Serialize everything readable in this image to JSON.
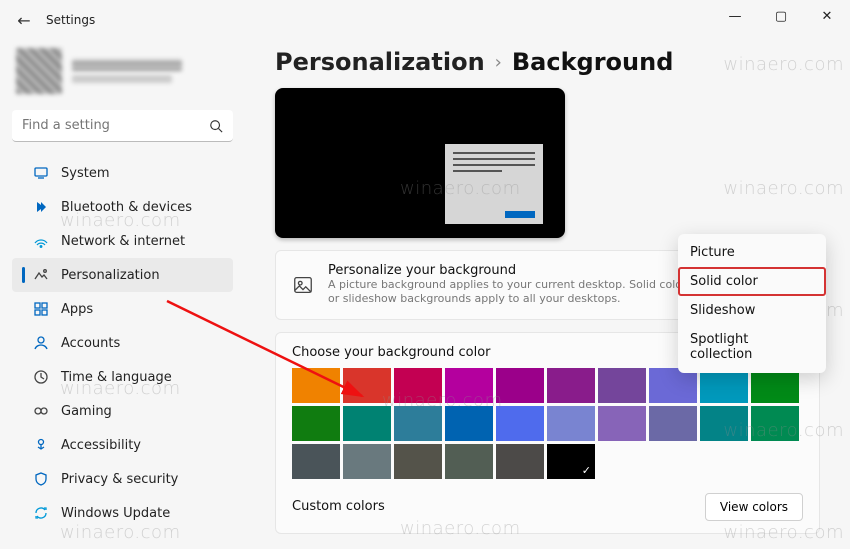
{
  "app": {
    "back_arrow": "←",
    "title": "Settings"
  },
  "window_controls": {
    "min": "—",
    "max": "▢",
    "close": "✕"
  },
  "search": {
    "placeholder": "Find a setting"
  },
  "sidebar": {
    "items": [
      {
        "label": "System"
      },
      {
        "label": "Bluetooth & devices"
      },
      {
        "label": "Network & internet"
      },
      {
        "label": "Personalization"
      },
      {
        "label": "Apps"
      },
      {
        "label": "Accounts"
      },
      {
        "label": "Time & language"
      },
      {
        "label": "Gaming"
      },
      {
        "label": "Accessibility"
      },
      {
        "label": "Privacy & security"
      },
      {
        "label": "Windows Update"
      }
    ],
    "selected_index": 3
  },
  "breadcrumb": {
    "parent": "Personalization",
    "sep": "›",
    "current": "Background"
  },
  "info_card": {
    "title": "Personalize your background",
    "subtitle": "A picture background applies to your current desktop. Solid color or slideshow backgrounds apply to all your desktops."
  },
  "colors_card": {
    "title": "Choose your background color",
    "rows": [
      [
        "#f08200",
        "#d9352b",
        "#c30052",
        "#b4009e",
        "#9b008a",
        "#891c8b",
        "#74459b",
        "#6b69d6",
        "#0099bc",
        "#008a17"
      ],
      [
        "#107c10",
        "#008272",
        "#2d7d9a",
        "#0063b1",
        "#4f6bed",
        "#7984d1",
        "#8764b8",
        "#6b69a6",
        "#038387",
        "#008a52"
      ],
      [
        "#4a5459",
        "#69797e",
        "#54534a",
        "#525e54",
        "#4c4a48",
        "#000000"
      ]
    ],
    "selected": [
      2,
      5
    ],
    "custom_label": "Custom colors",
    "view_button": "View colors"
  },
  "dropdown": {
    "options": [
      "Picture",
      "Solid color",
      "Slideshow",
      "Spotlight collection"
    ],
    "highlighted_index": 1
  },
  "watermark": "winaero.com"
}
